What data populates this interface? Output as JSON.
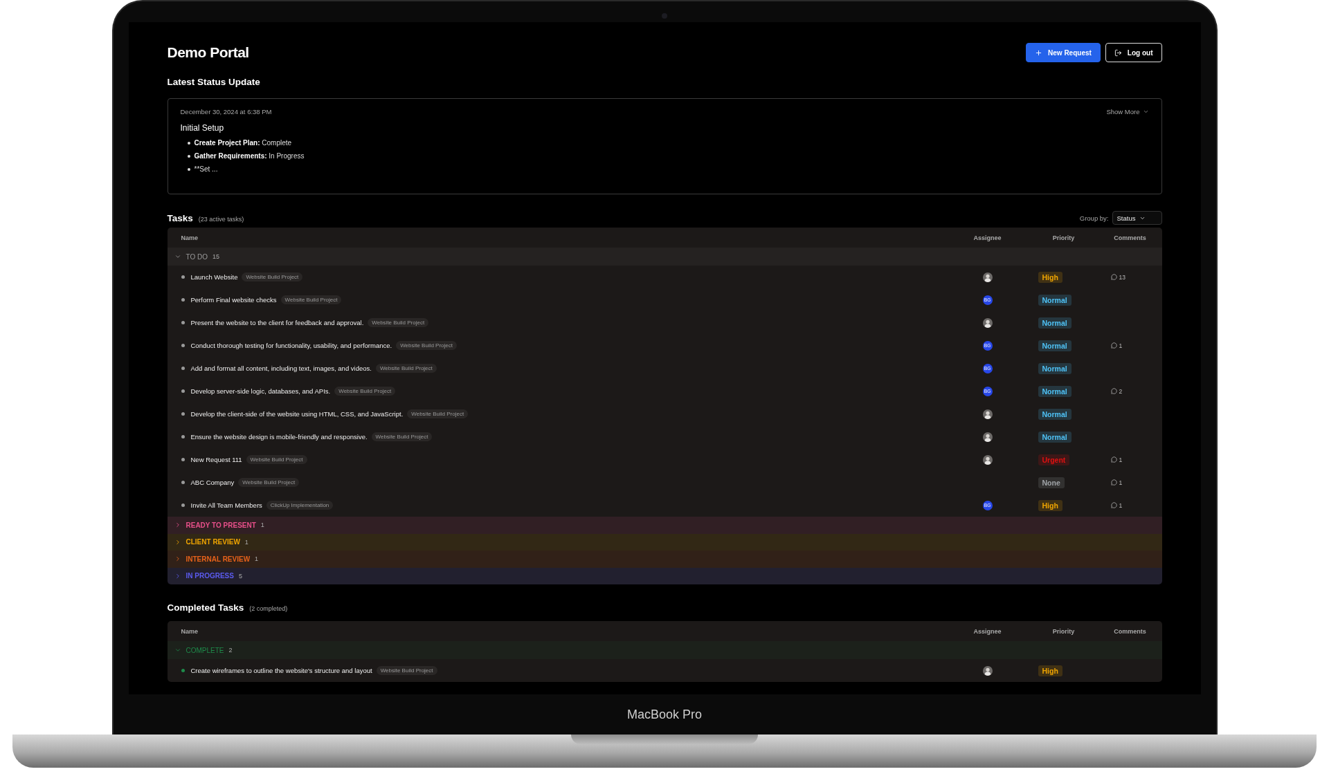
{
  "header": {
    "title": "Demo Portal",
    "buttons": [
      {
        "label": "New Request",
        "kind": "primary"
      },
      {
        "label": "Log out",
        "kind": "outline"
      }
    ]
  },
  "status_update": {
    "heading": "Latest Status Update",
    "date": "December 30, 2024 at 6:38 PM",
    "show_more": "Show More",
    "title": "Initial Setup",
    "bullets": [
      {
        "label": "Create Project Plan:",
        "value": "Complete"
      },
      {
        "label": "Gather Requirements:",
        "value": "In Progress"
      },
      {
        "value": "**Set ..."
      }
    ]
  },
  "tasks": {
    "heading": "Tasks",
    "count": "(23 active tasks)",
    "group_by_label": "Group by:",
    "group_by_value": "Status",
    "columns": [
      "Name",
      "Assignee",
      "Priority",
      "Comments"
    ],
    "groups": [
      {
        "name": "TO DO",
        "count": "15",
        "color": "#9a9a9a",
        "expanded": true,
        "tasks": [
          {
            "name": "Launch Website",
            "project": "Website Build Project",
            "assignee": {
              "kind": "photo"
            },
            "priority": {
              "label": "High",
              "color": "#f0a500"
            },
            "comments": "13"
          },
          {
            "name": "Perform Final website checks",
            "project": "Website Build Project",
            "assignee": {
              "kind": "initials",
              "initials": "BG"
            },
            "priority": {
              "label": "Normal",
              "color": "#4fc3f7"
            }
          },
          {
            "name": "Present the website to the client for feedback and approval.",
            "project": "Website Build Project",
            "assignee": {
              "kind": "photo"
            },
            "priority": {
              "label": "Normal",
              "color": "#4fc3f7"
            }
          },
          {
            "name": "Conduct thorough testing for functionality, usability, and performance.",
            "project": "Website Build Project",
            "assignee": {
              "kind": "initials",
              "initials": "BG"
            },
            "priority": {
              "label": "Normal",
              "color": "#4fc3f7"
            },
            "comments": "1"
          },
          {
            "name": "Add and format all content, including text, images, and videos.",
            "project": "Website Build Project",
            "assignee": {
              "kind": "initials",
              "initials": "BG"
            },
            "priority": {
              "label": "Normal",
              "color": "#4fc3f7"
            }
          },
          {
            "name": "Develop server-side logic, databases, and APIs.",
            "project": "Website Build Project",
            "assignee": {
              "kind": "initials",
              "initials": "BG"
            },
            "priority": {
              "label": "Normal",
              "color": "#4fc3f7"
            },
            "comments": "2"
          },
          {
            "name": "Develop the client-side of the website using HTML, CSS, and JavaScript.",
            "project": "Website Build Project",
            "assignee": {
              "kind": "photo"
            },
            "priority": {
              "label": "Normal",
              "color": "#4fc3f7"
            }
          },
          {
            "name": "Ensure the website design is mobile-friendly and responsive.",
            "project": "Website Build Project",
            "assignee": {
              "kind": "photo"
            },
            "priority": {
              "label": "Normal",
              "color": "#4fc3f7"
            }
          },
          {
            "name": "New Request 111",
            "project": "Website Build Project",
            "assignee": {
              "kind": "photo"
            },
            "priority": {
              "label": "Urgent",
              "color": "#e01010"
            },
            "comments": "1"
          },
          {
            "name": "ABC Company",
            "project": "Website Build Project",
            "priority": {
              "label": "None",
              "color": "#a0a4a8"
            },
            "comments": "1"
          },
          {
            "name": "Invite All Team Members",
            "project": "ClickUp Implementation",
            "assignee": {
              "kind": "initials",
              "initials": "BG"
            },
            "priority": {
              "label": "High",
              "color": "#f0a500"
            },
            "comments": "1"
          }
        ]
      },
      {
        "name": "READY TO PRESENT",
        "count": "1",
        "color": "#e8508a",
        "expanded": false
      },
      {
        "name": "CLIENT REVIEW",
        "count": "1",
        "color": "#f0a500",
        "expanded": false
      },
      {
        "name": "INTERNAL REVIEW",
        "count": "1",
        "color": "#e8621a",
        "expanded": false
      },
      {
        "name": "IN PROGRESS",
        "count": "5",
        "color": "#5b5bf0",
        "expanded": false
      }
    ]
  },
  "completed": {
    "heading": "Completed Tasks",
    "count": "(2 completed)",
    "columns": [
      "Name",
      "Assignee",
      "Priority",
      "Comments"
    ],
    "groups": [
      {
        "name": "COMPLETE",
        "count": "2",
        "color": "#1e8a4a",
        "expanded": true,
        "tasks": [
          {
            "name": "Create wireframes to outline the website's structure and layout",
            "project": "Website Build Project",
            "assignee": {
              "kind": "photo"
            },
            "priority": {
              "label": "High",
              "color": "#f0a500"
            }
          }
        ]
      }
    ]
  },
  "device": {
    "label": "MacBook Pro"
  }
}
